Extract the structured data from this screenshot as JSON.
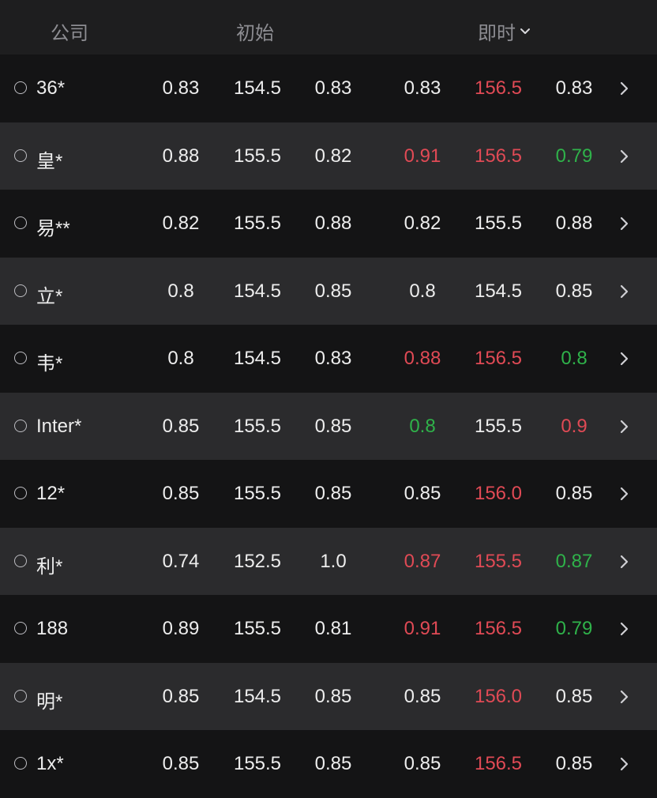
{
  "header": {
    "company": "公司",
    "initial": "初始",
    "live": "即时"
  },
  "colors": {
    "up": "#e04a55",
    "down": "#2fb24a",
    "neutral": "#ededed"
  },
  "icons": {
    "header_dropdown": "chevron-down-icon",
    "row_select": "radio-circle-icon",
    "row_detail": "chevron-right-icon"
  },
  "rows": [
    {
      "name": "36*",
      "initial": [
        "0.83",
        "154.5",
        "0.83"
      ],
      "live": [
        "0.83",
        "156.5",
        "0.83"
      ],
      "live_trend": [
        "neutral",
        "up",
        "neutral"
      ]
    },
    {
      "name": "皇*",
      "initial": [
        "0.88",
        "155.5",
        "0.82"
      ],
      "live": [
        "0.91",
        "156.5",
        "0.79"
      ],
      "live_trend": [
        "up",
        "up",
        "down"
      ]
    },
    {
      "name": "易**",
      "initial": [
        "0.82",
        "155.5",
        "0.88"
      ],
      "live": [
        "0.82",
        "155.5",
        "0.88"
      ],
      "live_trend": [
        "neutral",
        "neutral",
        "neutral"
      ]
    },
    {
      "name": "立*",
      "initial": [
        "0.8",
        "154.5",
        "0.85"
      ],
      "live": [
        "0.8",
        "154.5",
        "0.85"
      ],
      "live_trend": [
        "neutral",
        "neutral",
        "neutral"
      ]
    },
    {
      "name": "韦*",
      "initial": [
        "0.8",
        "154.5",
        "0.83"
      ],
      "live": [
        "0.88",
        "156.5",
        "0.8"
      ],
      "live_trend": [
        "up",
        "up",
        "down"
      ]
    },
    {
      "name": "Inter*",
      "initial": [
        "0.85",
        "155.5",
        "0.85"
      ],
      "live": [
        "0.8",
        "155.5",
        "0.9"
      ],
      "live_trend": [
        "down",
        "neutral",
        "up"
      ]
    },
    {
      "name": "12*",
      "initial": [
        "0.85",
        "155.5",
        "0.85"
      ],
      "live": [
        "0.85",
        "156.0",
        "0.85"
      ],
      "live_trend": [
        "neutral",
        "up",
        "neutral"
      ]
    },
    {
      "name": "利*",
      "initial": [
        "0.74",
        "152.5",
        "1.0"
      ],
      "live": [
        "0.87",
        "155.5",
        "0.87"
      ],
      "live_trend": [
        "up",
        "up",
        "down"
      ]
    },
    {
      "name": "188",
      "initial": [
        "0.89",
        "155.5",
        "0.81"
      ],
      "live": [
        "0.91",
        "156.5",
        "0.79"
      ],
      "live_trend": [
        "up",
        "up",
        "down"
      ]
    },
    {
      "name": "明*",
      "initial": [
        "0.85",
        "154.5",
        "0.85"
      ],
      "live": [
        "0.85",
        "156.0",
        "0.85"
      ],
      "live_trend": [
        "neutral",
        "up",
        "neutral"
      ]
    },
    {
      "name": "1x*",
      "initial": [
        "0.85",
        "155.5",
        "0.85"
      ],
      "live": [
        "0.85",
        "156.5",
        "0.85"
      ],
      "live_trend": [
        "neutral",
        "up",
        "neutral"
      ]
    }
  ]
}
